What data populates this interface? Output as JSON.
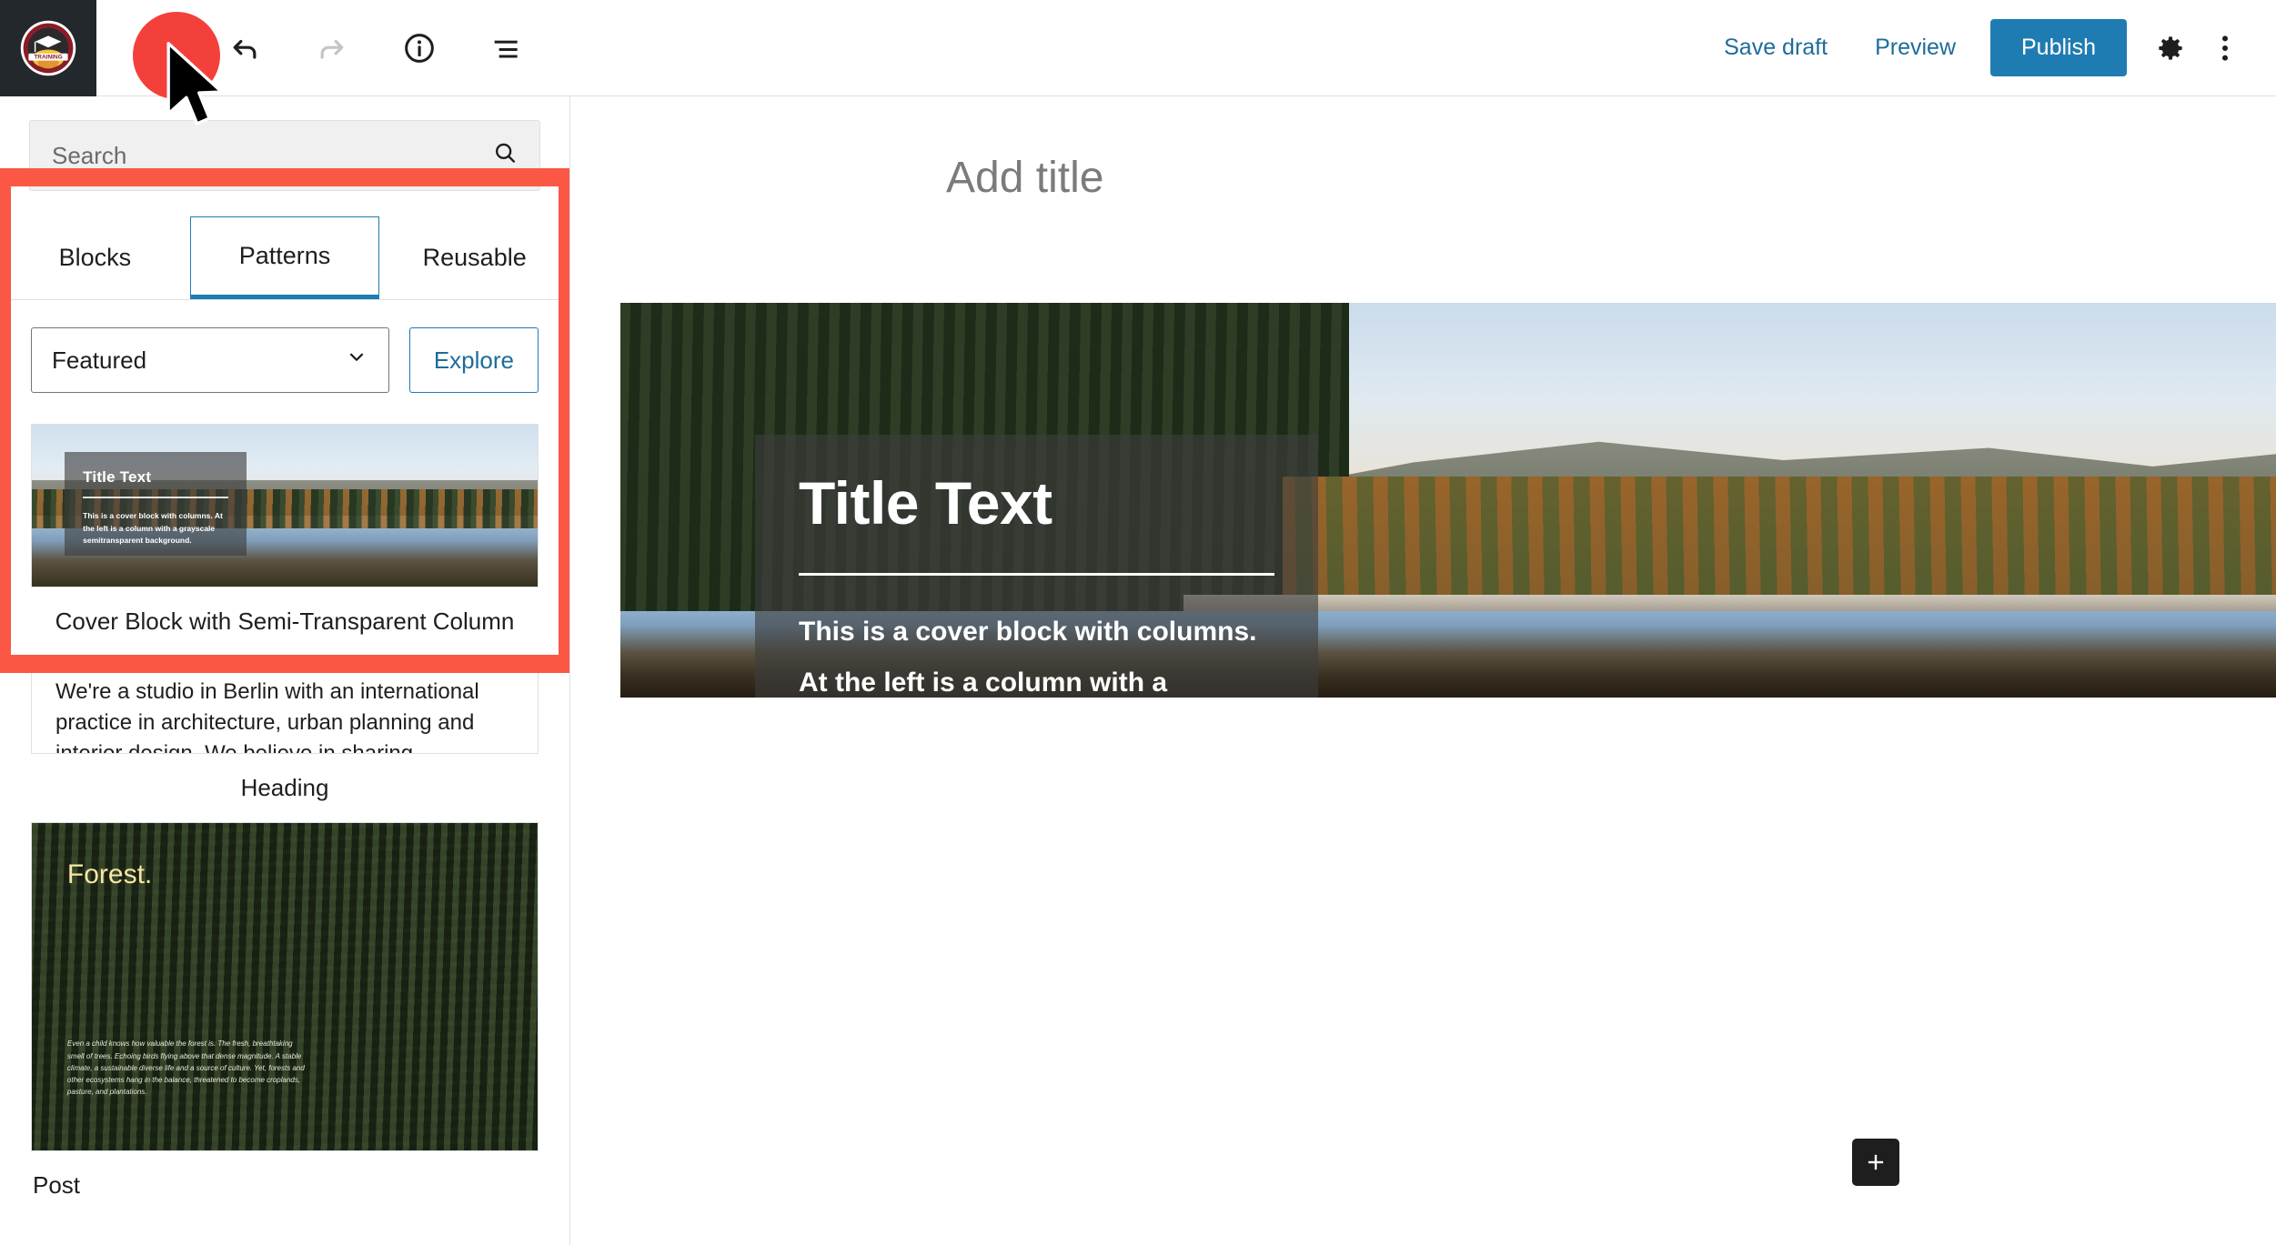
{
  "topbar": {
    "site_logo_alt": "Training badge logo",
    "logo_text": "TRAINING",
    "tools": [
      {
        "name": "edit-pencil-icon",
        "label": "Edit"
      },
      {
        "name": "undo-icon",
        "label": "Undo"
      },
      {
        "name": "redo-icon",
        "label": "Redo"
      },
      {
        "name": "info-icon",
        "label": "Details"
      },
      {
        "name": "list-view-icon",
        "label": "List view"
      }
    ],
    "save_draft_label": "Save draft",
    "preview_label": "Preview",
    "publish_label": "Publish",
    "settings_icon": "gear-icon",
    "more_icon": "kebab-menu-icon",
    "publish_color": "#1f7cb3",
    "link_color": "#1e6c9b"
  },
  "inserter": {
    "search": {
      "placeholder": "Search",
      "value": "",
      "icon": "search-icon"
    },
    "tabs": [
      {
        "label": "Blocks",
        "active": false
      },
      {
        "label": "Patterns",
        "active": true
      },
      {
        "label": "Reusable",
        "active": false
      }
    ],
    "category_select": {
      "value": "Featured",
      "icon": "chevron-down-icon"
    },
    "explore_label": "Explore",
    "patterns": [
      {
        "caption": "Cover Block with Semi-Transparent Column",
        "preview_title": "Title Text",
        "preview_body": "This is a cover block with columns. At the left is a column with a grayscale semitransparent background."
      },
      {
        "caption": "Heading",
        "preview_body": "We're a studio in Berlin with an international practice in architecture, urban planning and interior design. We believe in sharing knowledge and promoting dialogue to increase the creative potential of collaboration."
      },
      {
        "caption": "Post",
        "preview_title": "Forest.",
        "preview_body": "Even a child knows how valuable the forest is. The fresh, breathtaking smell of trees. Echoing birds flying above that dense magnitude. A stable climate, a sustainable diverse life and a source of culture. Yet, forests and other ecosystems hang in the balance, threatened to become croplands, pasture, and plantations."
      }
    ]
  },
  "editor": {
    "title_placeholder": "Add title",
    "cover_block": {
      "title": "Title Text",
      "body": "This is a cover block with columns. At the left is a column with a grayscale semitransparent background."
    },
    "add_block_icon": "plus-icon"
  },
  "annotation": {
    "highlight_color": "#fb5745",
    "cursor_color": "#f4403a"
  }
}
